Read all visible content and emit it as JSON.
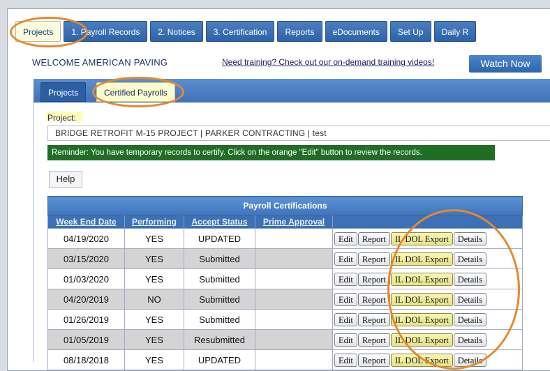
{
  "main_nav": {
    "tabs": [
      {
        "label": "Projects",
        "active": true
      },
      {
        "label": "1. Payroll Records",
        "active": false
      },
      {
        "label": "2. Notices",
        "active": false
      },
      {
        "label": "3. Certification",
        "active": false
      },
      {
        "label": "Reports",
        "active": false
      },
      {
        "label": "eDocuments",
        "active": false
      },
      {
        "label": "Set Up",
        "active": false
      },
      {
        "label": "Daily R",
        "active": false
      }
    ]
  },
  "header": {
    "welcome": "WELCOME AMERICAN PAVING",
    "training_link": "Need training? Check out our on-demand training videos!",
    "watch_now": "Watch Now"
  },
  "sub_tabs": {
    "projects": "Projects",
    "certified": "Certified Payrolls"
  },
  "project": {
    "label": "Project:",
    "selected": "BRIDGE RETROFIT M-15 PROJECT | PARKER CONTRACTING | test"
  },
  "reminder": "Reminder: You have temporary records to certify. Click on the orange \"Edit\" button to review the records.",
  "help_label": "Help",
  "table": {
    "caption": "Payroll Certifications",
    "columns": [
      "Week End Date",
      "Performing",
      "Accept Status",
      "Prime Approval"
    ],
    "action_labels": {
      "edit": "Edit",
      "report": "Report",
      "export": "IL DOL Export",
      "details": "Details"
    },
    "rows": [
      {
        "date": "04/19/2020",
        "performing": "YES",
        "status": "UPDATED",
        "prime": ""
      },
      {
        "date": "03/15/2020",
        "performing": "YES",
        "status": "Submitted",
        "prime": ""
      },
      {
        "date": "01/03/2020",
        "performing": "YES",
        "status": "Submitted",
        "prime": ""
      },
      {
        "date": "04/20/2019",
        "performing": "NO",
        "status": "Submitted",
        "prime": ""
      },
      {
        "date": "01/26/2019",
        "performing": "YES",
        "status": "Submitted",
        "prime": ""
      },
      {
        "date": "01/05/2019",
        "performing": "YES",
        "status": "Resubmitted",
        "prime": ""
      },
      {
        "date": "08/18/2018",
        "performing": "YES",
        "status": "UPDATED",
        "prime": ""
      }
    ]
  },
  "colors": {
    "nav_blue": "#2f62a8",
    "active_tab": "#fbfbe0",
    "reminder_green": "#1f6e24",
    "highlight_ring": "#e58a2e"
  }
}
